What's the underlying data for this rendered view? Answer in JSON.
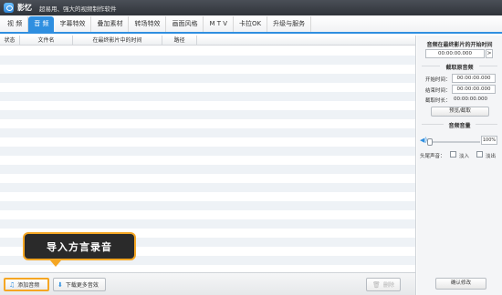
{
  "titlebar": {
    "app_name": "影忆",
    "slogan": "超易用、强大的视频制作软件"
  },
  "tabs": [
    {
      "label": "视  频",
      "active": false
    },
    {
      "label": "音  频",
      "active": true
    },
    {
      "label": "字幕特效",
      "active": false
    },
    {
      "label": "叠加素材",
      "active": false
    },
    {
      "label": "转场特效",
      "active": false
    },
    {
      "label": "画面风格",
      "active": false
    },
    {
      "label": "M T V",
      "active": false
    },
    {
      "label": "卡拉OK",
      "active": false
    },
    {
      "label": "升级与服务",
      "active": false
    }
  ],
  "table": {
    "columns": [
      "状态",
      "文件名",
      "在最终影片中的时间",
      "路径"
    ]
  },
  "callout": {
    "text": "导入方言录音"
  },
  "bottom": {
    "add_label": "添加音频",
    "download_label": "下载更多音效",
    "delete_label": "删除"
  },
  "right_panel": {
    "start_title": "音频在最终影片的开始时间",
    "start_time": "00:00:00.000",
    "arrow": ">",
    "clip_title": "截取原音频",
    "start_label": "开始时间：",
    "start_value": "00:00:00.000",
    "end_label": "结束时间：",
    "end_value": "00:00:00.000",
    "duration_label": "截取时长：",
    "duration_value": "00:00:00.000",
    "preview_button": "预览/截取",
    "volume_title": "音频音量",
    "volume_value": "100%",
    "volume_level": 0.06,
    "fade_label": "头尾声音：",
    "fade_in": "淡入",
    "fade_out": "淡出",
    "confirm_button": "确认修改"
  },
  "colors": {
    "accent": "#2f8fe0",
    "callout": "#f5a623",
    "titlebar": "#3a3e45"
  }
}
